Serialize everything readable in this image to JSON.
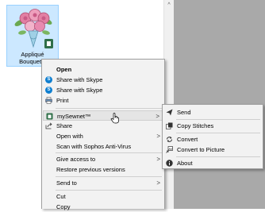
{
  "file": {
    "name_line1": "Appliqué",
    "name_line2": "Bouquet.v"
  },
  "context_menu": {
    "open": "Open",
    "share_skype_1": "Share with Skype",
    "share_skype_2": "Share with Skype",
    "print": "Print",
    "mysewnet": "mySewnet™",
    "share": "Share",
    "open_with": "Open with",
    "scan": "Scan with Sophos Anti-Virus",
    "give_access": "Give access to",
    "restore": "Restore previous versions",
    "send_to": "Send to",
    "cut": "Cut",
    "copy": "Copy"
  },
  "submenu": {
    "send": "Send",
    "copy_stitches": "Copy Stitches",
    "convert": "Convert",
    "convert_to_picture": "Convert to Picture",
    "about": "About"
  },
  "colors": {
    "selection": "#cce8ff",
    "menu_bg": "#f2f2f2",
    "gray_pane": "#a9a9a9"
  },
  "icons": [
    "skype-icon",
    "printer-icon",
    "mysewnet-icon",
    "share-icon",
    "send-icon",
    "copy-stitches-icon",
    "convert-icon",
    "convert-to-picture-icon",
    "info-icon",
    "mouse-cursor-icon"
  ]
}
